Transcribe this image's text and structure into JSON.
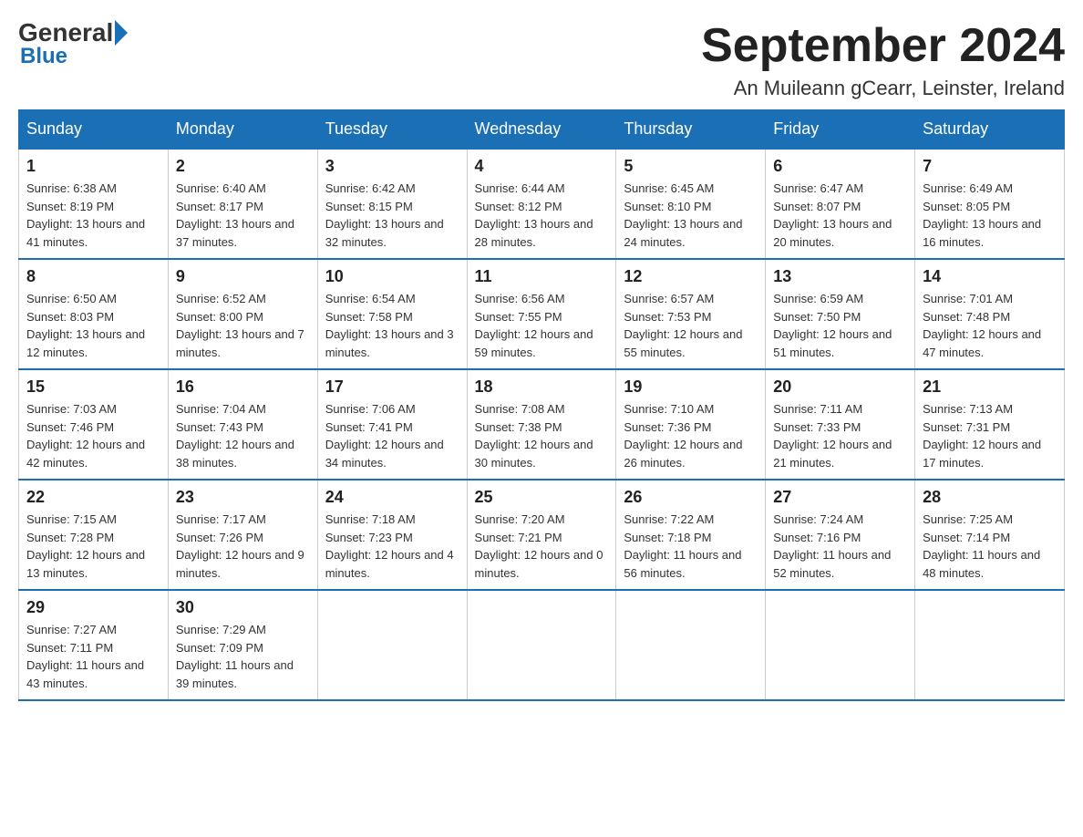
{
  "logo": {
    "general": "General",
    "blue": "Blue"
  },
  "header": {
    "month_title": "September 2024",
    "location": "An Muileann gCearr, Leinster, Ireland"
  },
  "days_of_week": [
    "Sunday",
    "Monday",
    "Tuesday",
    "Wednesday",
    "Thursday",
    "Friday",
    "Saturday"
  ],
  "weeks": [
    [
      {
        "day": "1",
        "sunrise": "6:38 AM",
        "sunset": "8:19 PM",
        "daylight": "13 hours and 41 minutes."
      },
      {
        "day": "2",
        "sunrise": "6:40 AM",
        "sunset": "8:17 PM",
        "daylight": "13 hours and 37 minutes."
      },
      {
        "day": "3",
        "sunrise": "6:42 AM",
        "sunset": "8:15 PM",
        "daylight": "13 hours and 32 minutes."
      },
      {
        "day": "4",
        "sunrise": "6:44 AM",
        "sunset": "8:12 PM",
        "daylight": "13 hours and 28 minutes."
      },
      {
        "day": "5",
        "sunrise": "6:45 AM",
        "sunset": "8:10 PM",
        "daylight": "13 hours and 24 minutes."
      },
      {
        "day": "6",
        "sunrise": "6:47 AM",
        "sunset": "8:07 PM",
        "daylight": "13 hours and 20 minutes."
      },
      {
        "day": "7",
        "sunrise": "6:49 AM",
        "sunset": "8:05 PM",
        "daylight": "13 hours and 16 minutes."
      }
    ],
    [
      {
        "day": "8",
        "sunrise": "6:50 AM",
        "sunset": "8:03 PM",
        "daylight": "13 hours and 12 minutes."
      },
      {
        "day": "9",
        "sunrise": "6:52 AM",
        "sunset": "8:00 PM",
        "daylight": "13 hours and 7 minutes."
      },
      {
        "day": "10",
        "sunrise": "6:54 AM",
        "sunset": "7:58 PM",
        "daylight": "13 hours and 3 minutes."
      },
      {
        "day": "11",
        "sunrise": "6:56 AM",
        "sunset": "7:55 PM",
        "daylight": "12 hours and 59 minutes."
      },
      {
        "day": "12",
        "sunrise": "6:57 AM",
        "sunset": "7:53 PM",
        "daylight": "12 hours and 55 minutes."
      },
      {
        "day": "13",
        "sunrise": "6:59 AM",
        "sunset": "7:50 PM",
        "daylight": "12 hours and 51 minutes."
      },
      {
        "day": "14",
        "sunrise": "7:01 AM",
        "sunset": "7:48 PM",
        "daylight": "12 hours and 47 minutes."
      }
    ],
    [
      {
        "day": "15",
        "sunrise": "7:03 AM",
        "sunset": "7:46 PM",
        "daylight": "12 hours and 42 minutes."
      },
      {
        "day": "16",
        "sunrise": "7:04 AM",
        "sunset": "7:43 PM",
        "daylight": "12 hours and 38 minutes."
      },
      {
        "day": "17",
        "sunrise": "7:06 AM",
        "sunset": "7:41 PM",
        "daylight": "12 hours and 34 minutes."
      },
      {
        "day": "18",
        "sunrise": "7:08 AM",
        "sunset": "7:38 PM",
        "daylight": "12 hours and 30 minutes."
      },
      {
        "day": "19",
        "sunrise": "7:10 AM",
        "sunset": "7:36 PM",
        "daylight": "12 hours and 26 minutes."
      },
      {
        "day": "20",
        "sunrise": "7:11 AM",
        "sunset": "7:33 PM",
        "daylight": "12 hours and 21 minutes."
      },
      {
        "day": "21",
        "sunrise": "7:13 AM",
        "sunset": "7:31 PM",
        "daylight": "12 hours and 17 minutes."
      }
    ],
    [
      {
        "day": "22",
        "sunrise": "7:15 AM",
        "sunset": "7:28 PM",
        "daylight": "12 hours and 13 minutes."
      },
      {
        "day": "23",
        "sunrise": "7:17 AM",
        "sunset": "7:26 PM",
        "daylight": "12 hours and 9 minutes."
      },
      {
        "day": "24",
        "sunrise": "7:18 AM",
        "sunset": "7:23 PM",
        "daylight": "12 hours and 4 minutes."
      },
      {
        "day": "25",
        "sunrise": "7:20 AM",
        "sunset": "7:21 PM",
        "daylight": "12 hours and 0 minutes."
      },
      {
        "day": "26",
        "sunrise": "7:22 AM",
        "sunset": "7:18 PM",
        "daylight": "11 hours and 56 minutes."
      },
      {
        "day": "27",
        "sunrise": "7:24 AM",
        "sunset": "7:16 PM",
        "daylight": "11 hours and 52 minutes."
      },
      {
        "day": "28",
        "sunrise": "7:25 AM",
        "sunset": "7:14 PM",
        "daylight": "11 hours and 48 minutes."
      }
    ],
    [
      {
        "day": "29",
        "sunrise": "7:27 AM",
        "sunset": "7:11 PM",
        "daylight": "11 hours and 43 minutes."
      },
      {
        "day": "30",
        "sunrise": "7:29 AM",
        "sunset": "7:09 PM",
        "daylight": "11 hours and 39 minutes."
      },
      null,
      null,
      null,
      null,
      null
    ]
  ]
}
